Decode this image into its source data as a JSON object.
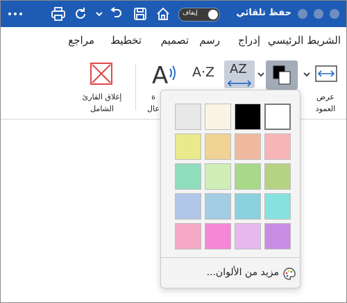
{
  "titlebar": {
    "title": "حفظ تلقائي",
    "autosave_toggle_label": "إيقاف"
  },
  "tabs": [
    {
      "label": "الشريط الرئيسي"
    },
    {
      "label": "إدراج"
    },
    {
      "label": "رسم"
    },
    {
      "label": "تصميم"
    },
    {
      "label": "تخطيط"
    },
    {
      "label": "مراجع"
    }
  ],
  "ribbon": {
    "column_width_label": "عرض العمود",
    "close_reader_label": "إغلاق القارئ الشامل",
    "partial_label_top": "ة",
    "partial_label_bottom": "عال",
    "sort_label": "A·Z",
    "text_spacing_label": "AZ"
  },
  "palette": {
    "colors": [
      "#e8e8e8",
      "#fdf3e5",
      "#000000",
      "#ffffff",
      "#e9ea8c",
      "#f0d395",
      "#efb99f",
      "#f8b5b8",
      "#8fddbd",
      "#d0efb8",
      "#a7d989",
      "#b6d283",
      "#b2c6ea",
      "#a3cce5",
      "#8bd1dd",
      "#86e2df",
      "#f5a8c4",
      "#f587d6",
      "#e8b8ef",
      "#c98ce5"
    ],
    "selected_index": 3,
    "more_colors_label": "مزيد من الألوان..."
  }
}
